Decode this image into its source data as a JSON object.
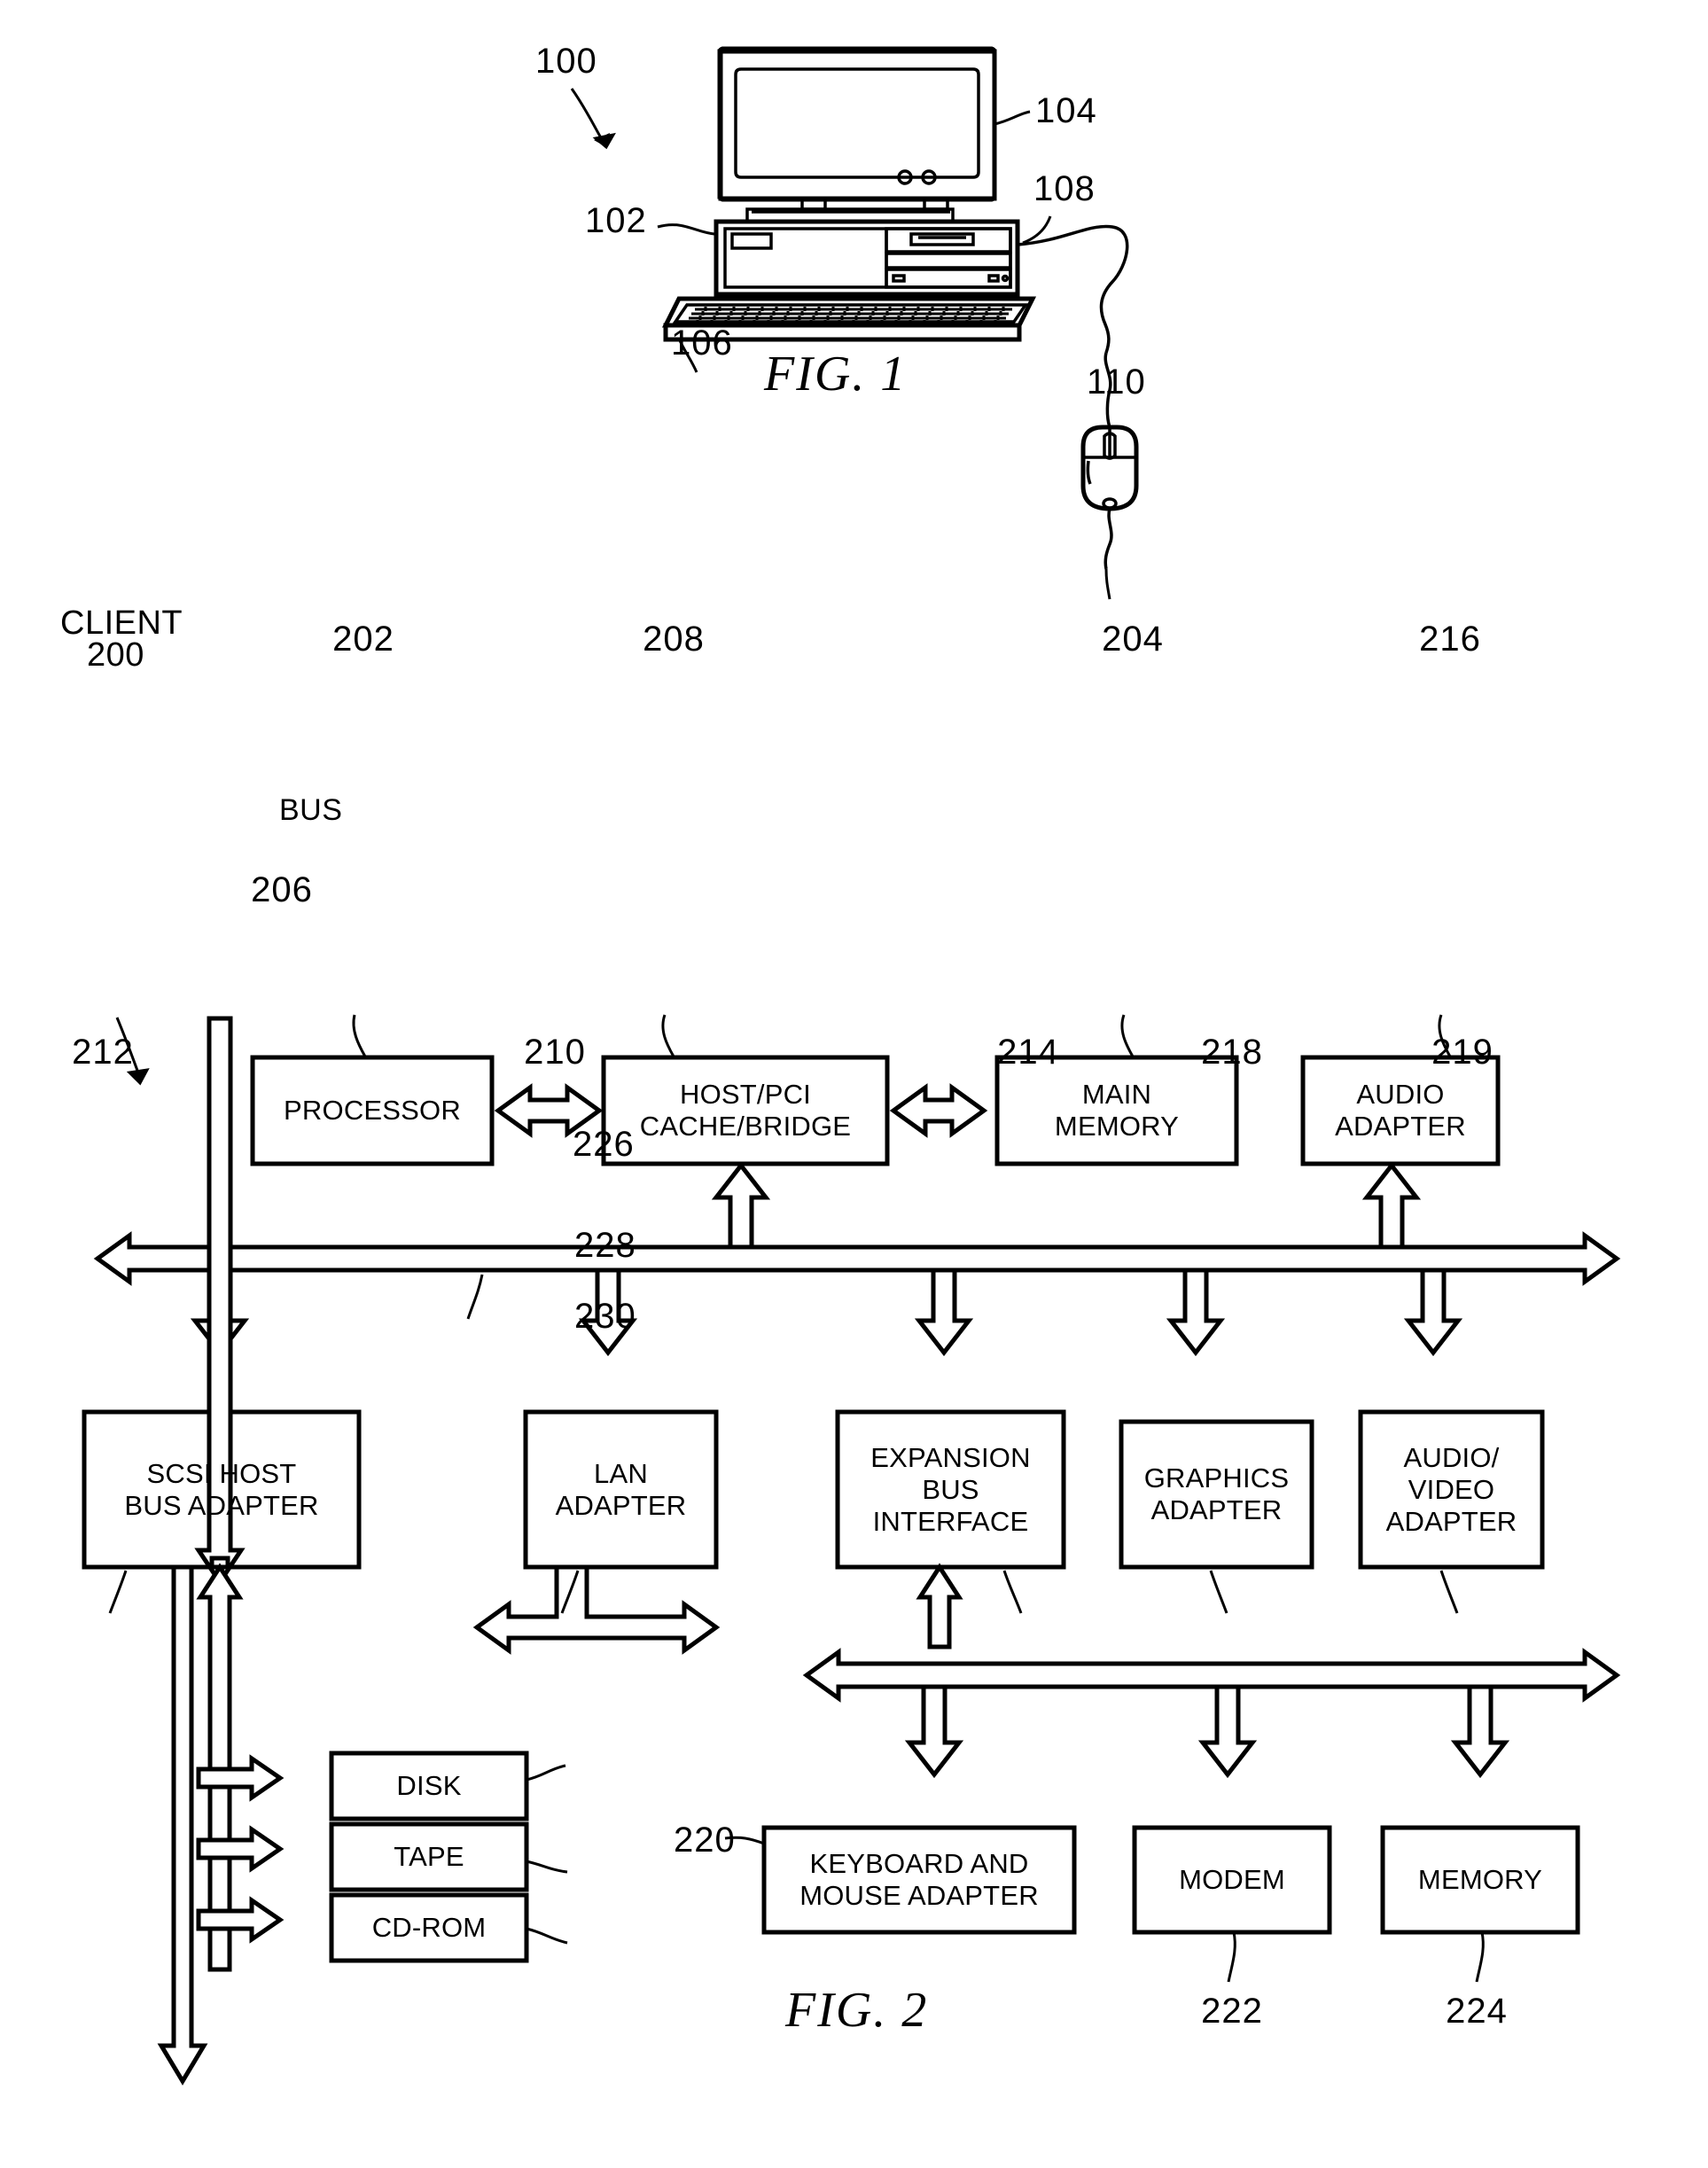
{
  "document": {
    "type": "patent-drawing-sheet",
    "figures": [
      "FIG. 1",
      "FIG. 2"
    ]
  },
  "fig1": {
    "title": "FIG. 1",
    "callouts": [
      {
        "id": "fig1-ref-100",
        "number": "100",
        "target": "data-processing-system"
      },
      {
        "id": "fig1-ref-104",
        "number": "104",
        "target": "display-monitor"
      },
      {
        "id": "fig1-ref-108",
        "number": "108",
        "target": "cable"
      },
      {
        "id": "fig1-ref-102",
        "number": "102",
        "target": "system-unit"
      },
      {
        "id": "fig1-ref-106",
        "number": "106",
        "target": "keyboard"
      },
      {
        "id": "fig1-ref-110",
        "number": "110",
        "target": "mouse"
      }
    ]
  },
  "fig2": {
    "title": "FIG. 2",
    "system_label": {
      "line1": "CLIENT",
      "line2": "200"
    },
    "bus_label": "BUS",
    "boxes": [
      {
        "id": "processor",
        "label": "PROCESSOR",
        "ref": "202"
      },
      {
        "id": "host-pci-cache-bridge",
        "label": "HOST/PCI\nCACHE/BRIDGE",
        "ref": "208"
      },
      {
        "id": "main-memory",
        "label": "MAIN\nMEMORY",
        "ref": "204"
      },
      {
        "id": "audio-adapter",
        "label": "AUDIO\nADAPTER",
        "ref": "216"
      },
      {
        "id": "scsi-host-bus-adapter",
        "label": "SCSI HOST\nBUS ADAPTER",
        "ref": "212"
      },
      {
        "id": "lan-adapter",
        "label": "LAN\nADAPTER",
        "ref": "210"
      },
      {
        "id": "expansion-bus-interface",
        "label": "EXPANSION\nBUS\nINTERFACE",
        "ref": "214"
      },
      {
        "id": "graphics-adapter",
        "label": "GRAPHICS\nADAPTER",
        "ref": "218"
      },
      {
        "id": "audio-video-adapter",
        "label": "AUDIO/\nVIDEO\nADAPTER",
        "ref": "219"
      },
      {
        "id": "disk",
        "label": "DISK",
        "ref": "226"
      },
      {
        "id": "tape",
        "label": "TAPE",
        "ref": "228"
      },
      {
        "id": "cd-rom",
        "label": "CD-ROM",
        "ref": "230"
      },
      {
        "id": "keyboard-and-mouse-adapter",
        "label": "KEYBOARD AND\nMOUSE ADAPTER",
        "ref": "220"
      },
      {
        "id": "modem",
        "label": "MODEM",
        "ref": "222"
      },
      {
        "id": "memory",
        "label": "MEMORY",
        "ref": "224"
      }
    ],
    "labels": {
      "processor": "PROCESSOR",
      "host_pci_l1": "HOST/PCI",
      "host_pci_l2": "CACHE/BRIDGE",
      "main_memory_l1": "MAIN",
      "main_memory_l2": "MEMORY",
      "audio_adapter_l1": "AUDIO",
      "audio_adapter_l2": "ADAPTER",
      "scsi_l1": "SCSI HOST",
      "scsi_l2": "BUS ADAPTER",
      "lan_l1": "LAN",
      "lan_l2": "ADAPTER",
      "expansion_l1": "EXPANSION",
      "expansion_l2": "BUS",
      "expansion_l3": "INTERFACE",
      "graphics_l1": "GRAPHICS",
      "graphics_l2": "ADAPTER",
      "av_l1": "AUDIO/",
      "av_l2": "VIDEO",
      "av_l3": "ADAPTER",
      "disk": "DISK",
      "tape": "TAPE",
      "cdrom": "CD-ROM",
      "kbm_l1": "KEYBOARD AND",
      "kbm_l2": "MOUSE ADAPTER",
      "modem": "MODEM",
      "memory": "MEMORY"
    },
    "refs": {
      "r200": "200",
      "r202": "202",
      "r204": "204",
      "r206": "206",
      "r208": "208",
      "r210": "210",
      "r212": "212",
      "r214": "214",
      "r216": "216",
      "r218": "218",
      "r219": "219",
      "r220": "220",
      "r222": "222",
      "r224": "224",
      "r226": "226",
      "r228": "228",
      "r230": "230",
      "client": "CLIENT",
      "bus": "BUS"
    }
  },
  "fig1_refs": {
    "r100": "100",
    "r102": "102",
    "r104": "104",
    "r106": "106",
    "r108": "108",
    "r110": "110"
  },
  "colors": {
    "ink": "#000000",
    "paper": "#ffffff"
  }
}
